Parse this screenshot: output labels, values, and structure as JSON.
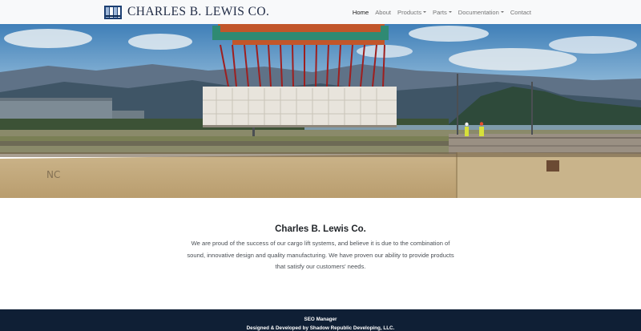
{
  "brand": {
    "name": "CHARLES B. LEWIS CO."
  },
  "nav": {
    "items": [
      {
        "label": "Home",
        "active": true,
        "dropdown": false
      },
      {
        "label": "About",
        "active": false,
        "dropdown": false
      },
      {
        "label": "Products",
        "active": false,
        "dropdown": true
      },
      {
        "label": "Parts",
        "active": false,
        "dropdown": true
      },
      {
        "label": "Documentation",
        "active": false,
        "dropdown": true
      },
      {
        "label": "Contact",
        "active": false,
        "dropdown": false
      }
    ]
  },
  "hero": {
    "image": "cargo-lift-loading-photo"
  },
  "content": {
    "title": "Charles B. Lewis Co.",
    "body": "We are proud of the success of our cargo lift systems, and believe it is due to the combination of sound, innovative design and quality manufacturing. We have proven our ability to provide products that satisfy our customers' needs."
  },
  "footer": {
    "line1": "SEO Manager",
    "line2": "Designed & Developed by Shadow Republic Developing, LLC."
  },
  "colors": {
    "navbar_bg": "#f8f9fa",
    "footer_bg": "#0f1f35",
    "brand_text": "#1f2a44"
  }
}
